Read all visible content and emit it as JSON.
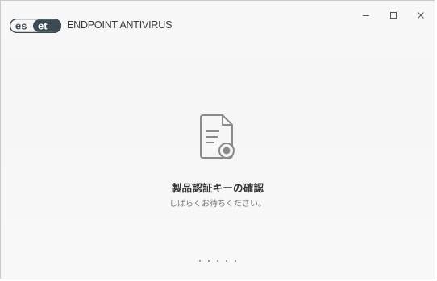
{
  "app": {
    "logo_text": "eset",
    "product_name": "ENDPOINT ANTIVIRUS"
  },
  "window_controls": {
    "minimize": "−",
    "maximize": "□",
    "close": "×"
  },
  "status": {
    "icon": "certificate-document-icon",
    "title": "製品認証キーの確認",
    "subtitle": "しばらくお待ちください。"
  },
  "loader": {
    "dot_count": 5
  },
  "colors": {
    "logo": "#3c4a52",
    "icon_stroke": "#8a8a8a",
    "background": "#f7f7f7"
  }
}
